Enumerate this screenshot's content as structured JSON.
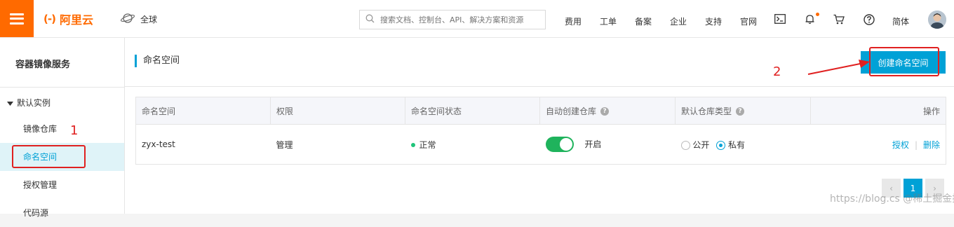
{
  "topbar": {
    "brand": "阿里云",
    "brand_mark": "(-)",
    "region": "全球",
    "search_placeholder": "搜索文档、控制台、API、解决方案和资源",
    "nav": [
      "费用",
      "工单",
      "备案",
      "企业",
      "支持",
      "官网"
    ],
    "language": "简体",
    "icons": [
      "menu-icon",
      "globe-icon",
      "search-icon",
      "terminal-icon",
      "bell-icon",
      "cart-icon",
      "help-icon",
      "avatar"
    ],
    "accent": "#ff6a00"
  },
  "sidebar": {
    "title": "容器镜像服务",
    "group": "默认实例",
    "items": [
      {
        "label": "镜像仓库"
      },
      {
        "label": "命名空间"
      },
      {
        "label": "授权管理"
      },
      {
        "label": "代码源"
      }
    ],
    "active_index": 1
  },
  "main": {
    "title": "命名空间",
    "create_button": "创建命名空间",
    "table": {
      "columns": [
        "命名空间",
        "权限",
        "命名空间状态",
        "自动创建仓库",
        "默认仓库类型",
        "操作"
      ],
      "rows": [
        {
          "name": "zyx-test",
          "permission": "管理",
          "status": "正常",
          "auto_create_label": "开启",
          "auto_create_on": true,
          "repo_type_options": [
            "公开",
            "私有"
          ],
          "repo_type_selected": "私有",
          "actions": [
            "授权",
            "删除"
          ]
        }
      ]
    },
    "pagination": {
      "prev": "‹",
      "current": "1",
      "next": "›"
    },
    "watermark": "https://blog.cs @稀土掘金技术社区"
  },
  "annotations": {
    "label_1": "1",
    "label_2": "2",
    "color": "#e02020"
  },
  "colors": {
    "primary": "#00a1d6",
    "switch_on": "#1fb35c",
    "status_ok": "#1fc47a"
  }
}
